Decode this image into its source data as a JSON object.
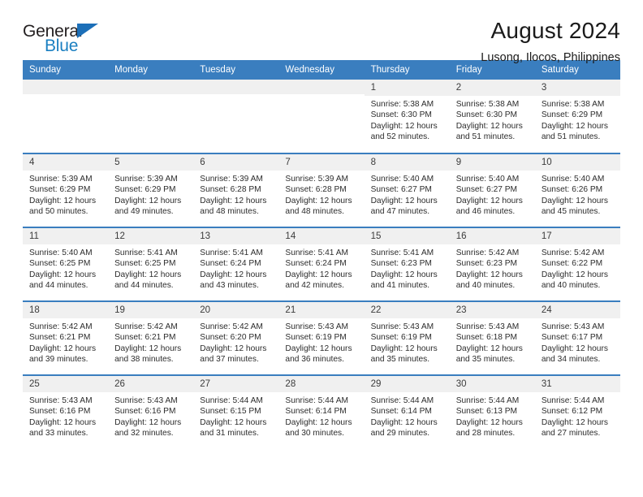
{
  "brand": {
    "name_part1": "General",
    "name_part2": "Blue",
    "triangle_color": "#1c6fb8"
  },
  "header": {
    "title": "August 2024",
    "subtitle": "Lusong, Ilocos, Philippines",
    "header_bg": "#3a7ebf"
  },
  "weekdays": [
    "Sunday",
    "Monday",
    "Tuesday",
    "Wednesday",
    "Thursday",
    "Friday",
    "Saturday"
  ],
  "weeks": [
    [
      {
        "date": "",
        "empty": true
      },
      {
        "date": "",
        "empty": true
      },
      {
        "date": "",
        "empty": true
      },
      {
        "date": "",
        "empty": true
      },
      {
        "date": "1",
        "sunrise": "Sunrise: 5:38 AM",
        "sunset": "Sunset: 6:30 PM",
        "daylight1": "Daylight: 12 hours",
        "daylight2": "and 52 minutes."
      },
      {
        "date": "2",
        "sunrise": "Sunrise: 5:38 AM",
        "sunset": "Sunset: 6:30 PM",
        "daylight1": "Daylight: 12 hours",
        "daylight2": "and 51 minutes."
      },
      {
        "date": "3",
        "sunrise": "Sunrise: 5:38 AM",
        "sunset": "Sunset: 6:29 PM",
        "daylight1": "Daylight: 12 hours",
        "daylight2": "and 51 minutes."
      }
    ],
    [
      {
        "date": "4",
        "sunrise": "Sunrise: 5:39 AM",
        "sunset": "Sunset: 6:29 PM",
        "daylight1": "Daylight: 12 hours",
        "daylight2": "and 50 minutes."
      },
      {
        "date": "5",
        "sunrise": "Sunrise: 5:39 AM",
        "sunset": "Sunset: 6:29 PM",
        "daylight1": "Daylight: 12 hours",
        "daylight2": "and 49 minutes."
      },
      {
        "date": "6",
        "sunrise": "Sunrise: 5:39 AM",
        "sunset": "Sunset: 6:28 PM",
        "daylight1": "Daylight: 12 hours",
        "daylight2": "and 48 minutes."
      },
      {
        "date": "7",
        "sunrise": "Sunrise: 5:39 AM",
        "sunset": "Sunset: 6:28 PM",
        "daylight1": "Daylight: 12 hours",
        "daylight2": "and 48 minutes."
      },
      {
        "date": "8",
        "sunrise": "Sunrise: 5:40 AM",
        "sunset": "Sunset: 6:27 PM",
        "daylight1": "Daylight: 12 hours",
        "daylight2": "and 47 minutes."
      },
      {
        "date": "9",
        "sunrise": "Sunrise: 5:40 AM",
        "sunset": "Sunset: 6:27 PM",
        "daylight1": "Daylight: 12 hours",
        "daylight2": "and 46 minutes."
      },
      {
        "date": "10",
        "sunrise": "Sunrise: 5:40 AM",
        "sunset": "Sunset: 6:26 PM",
        "daylight1": "Daylight: 12 hours",
        "daylight2": "and 45 minutes."
      }
    ],
    [
      {
        "date": "11",
        "sunrise": "Sunrise: 5:40 AM",
        "sunset": "Sunset: 6:25 PM",
        "daylight1": "Daylight: 12 hours",
        "daylight2": "and 44 minutes."
      },
      {
        "date": "12",
        "sunrise": "Sunrise: 5:41 AM",
        "sunset": "Sunset: 6:25 PM",
        "daylight1": "Daylight: 12 hours",
        "daylight2": "and 44 minutes."
      },
      {
        "date": "13",
        "sunrise": "Sunrise: 5:41 AM",
        "sunset": "Sunset: 6:24 PM",
        "daylight1": "Daylight: 12 hours",
        "daylight2": "and 43 minutes."
      },
      {
        "date": "14",
        "sunrise": "Sunrise: 5:41 AM",
        "sunset": "Sunset: 6:24 PM",
        "daylight1": "Daylight: 12 hours",
        "daylight2": "and 42 minutes."
      },
      {
        "date": "15",
        "sunrise": "Sunrise: 5:41 AM",
        "sunset": "Sunset: 6:23 PM",
        "daylight1": "Daylight: 12 hours",
        "daylight2": "and 41 minutes."
      },
      {
        "date": "16",
        "sunrise": "Sunrise: 5:42 AM",
        "sunset": "Sunset: 6:23 PM",
        "daylight1": "Daylight: 12 hours",
        "daylight2": "and 40 minutes."
      },
      {
        "date": "17",
        "sunrise": "Sunrise: 5:42 AM",
        "sunset": "Sunset: 6:22 PM",
        "daylight1": "Daylight: 12 hours",
        "daylight2": "and 40 minutes."
      }
    ],
    [
      {
        "date": "18",
        "sunrise": "Sunrise: 5:42 AM",
        "sunset": "Sunset: 6:21 PM",
        "daylight1": "Daylight: 12 hours",
        "daylight2": "and 39 minutes."
      },
      {
        "date": "19",
        "sunrise": "Sunrise: 5:42 AM",
        "sunset": "Sunset: 6:21 PM",
        "daylight1": "Daylight: 12 hours",
        "daylight2": "and 38 minutes."
      },
      {
        "date": "20",
        "sunrise": "Sunrise: 5:42 AM",
        "sunset": "Sunset: 6:20 PM",
        "daylight1": "Daylight: 12 hours",
        "daylight2": "and 37 minutes."
      },
      {
        "date": "21",
        "sunrise": "Sunrise: 5:43 AM",
        "sunset": "Sunset: 6:19 PM",
        "daylight1": "Daylight: 12 hours",
        "daylight2": "and 36 minutes."
      },
      {
        "date": "22",
        "sunrise": "Sunrise: 5:43 AM",
        "sunset": "Sunset: 6:19 PM",
        "daylight1": "Daylight: 12 hours",
        "daylight2": "and 35 minutes."
      },
      {
        "date": "23",
        "sunrise": "Sunrise: 5:43 AM",
        "sunset": "Sunset: 6:18 PM",
        "daylight1": "Daylight: 12 hours",
        "daylight2": "and 35 minutes."
      },
      {
        "date": "24",
        "sunrise": "Sunrise: 5:43 AM",
        "sunset": "Sunset: 6:17 PM",
        "daylight1": "Daylight: 12 hours",
        "daylight2": "and 34 minutes."
      }
    ],
    [
      {
        "date": "25",
        "sunrise": "Sunrise: 5:43 AM",
        "sunset": "Sunset: 6:16 PM",
        "daylight1": "Daylight: 12 hours",
        "daylight2": "and 33 minutes."
      },
      {
        "date": "26",
        "sunrise": "Sunrise: 5:43 AM",
        "sunset": "Sunset: 6:16 PM",
        "daylight1": "Daylight: 12 hours",
        "daylight2": "and 32 minutes."
      },
      {
        "date": "27",
        "sunrise": "Sunrise: 5:44 AM",
        "sunset": "Sunset: 6:15 PM",
        "daylight1": "Daylight: 12 hours",
        "daylight2": "and 31 minutes."
      },
      {
        "date": "28",
        "sunrise": "Sunrise: 5:44 AM",
        "sunset": "Sunset: 6:14 PM",
        "daylight1": "Daylight: 12 hours",
        "daylight2": "and 30 minutes."
      },
      {
        "date": "29",
        "sunrise": "Sunrise: 5:44 AM",
        "sunset": "Sunset: 6:14 PM",
        "daylight1": "Daylight: 12 hours",
        "daylight2": "and 29 minutes."
      },
      {
        "date": "30",
        "sunrise": "Sunrise: 5:44 AM",
        "sunset": "Sunset: 6:13 PM",
        "daylight1": "Daylight: 12 hours",
        "daylight2": "and 28 minutes."
      },
      {
        "date": "31",
        "sunrise": "Sunrise: 5:44 AM",
        "sunset": "Sunset: 6:12 PM",
        "daylight1": "Daylight: 12 hours",
        "daylight2": "and 27 minutes."
      }
    ]
  ]
}
